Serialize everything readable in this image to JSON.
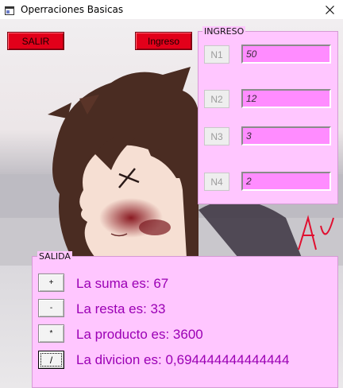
{
  "window": {
    "title": "Operraciones Basicas",
    "icon": "window-app-icon",
    "close_icon": "close-icon"
  },
  "toolbar": {
    "salir_label": "SALIR",
    "ingreso_label": "Ingreso"
  },
  "ingreso": {
    "legend": "INGRESO",
    "fields": [
      {
        "button_label": "N1",
        "value": "50"
      },
      {
        "button_label": "N2",
        "value": "12"
      },
      {
        "button_label": "N3",
        "value": "3"
      },
      {
        "button_label": "N4",
        "value": "2"
      }
    ]
  },
  "salida": {
    "legend": "SALIDA",
    "operations": [
      {
        "button_label": "+",
        "result": "La suma es: 67"
      },
      {
        "button_label": "-",
        "result": "La resta es: 33"
      },
      {
        "button_label": "*",
        "result": "La producto es: 3600"
      },
      {
        "button_label": "/",
        "result": "La divicion es: 0,694444444444444"
      }
    ]
  },
  "colors": {
    "panel_bg": "#ffc6ff",
    "field_bg": "#ff8cff",
    "button_red": "#e2001a",
    "result_text": "#9b00b4"
  }
}
